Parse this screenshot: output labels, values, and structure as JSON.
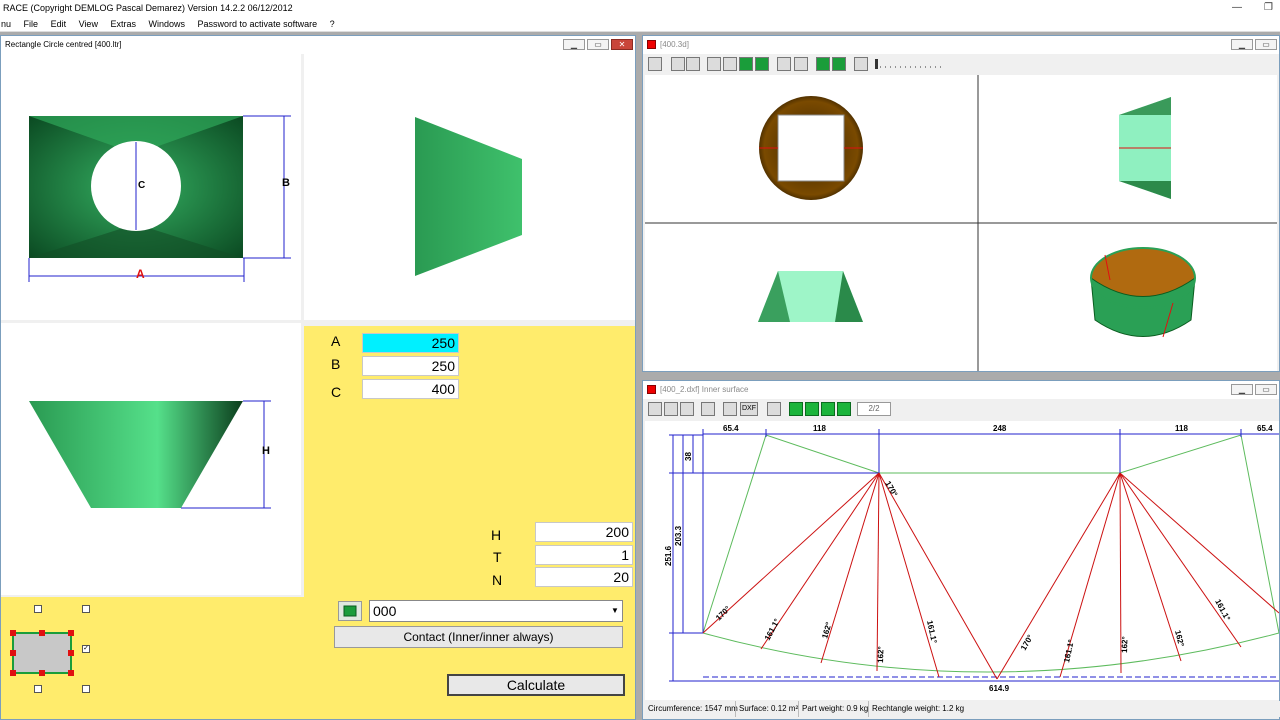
{
  "app": {
    "title": "RACE  (Copyright DEMLOG Pascal Demarez)  Version 14.2.2  06/12/2012",
    "minimize": "—",
    "restore": "❐"
  },
  "menu": [
    "nu",
    "File",
    "Edit",
    "View",
    "Extras",
    "Windows",
    "Password to activate software",
    "?"
  ],
  "window1": {
    "title": "Rectangle Circle centred  [400.ltr]",
    "labels": {
      "a": "A",
      "b": "B",
      "c": "C",
      "h": "H"
    },
    "params": [
      {
        "label": "A",
        "value": "250"
      },
      {
        "label": "B",
        "value": "250"
      },
      {
        "label": "C",
        "value": "400"
      },
      {
        "label": "H",
        "value": "200"
      },
      {
        "label": "T",
        "value": "1"
      },
      {
        "label": "N",
        "value": "20"
      }
    ],
    "combo_value": "000",
    "contact_label": "Contact (Inner/inner always)",
    "calculate_label": "Calculate",
    "check_mark": "✓"
  },
  "window2": {
    "title": "[400.3d]"
  },
  "window3": {
    "title": "[400_2.dxf]  Inner surface",
    "page": "2/2",
    "dxf_label": "DXF",
    "dims_top": [
      "65.4",
      "118",
      "248",
      "118",
      "65.4"
    ],
    "dims_left": [
      "38",
      "203.3",
      "251.6"
    ],
    "dim_bottom": "614.9",
    "angles": [
      "170°",
      "170°",
      "161.1°",
      "162°",
      "161.1°",
      "162°",
      "170°",
      "161.1°",
      "162°",
      "162°",
      "161.1°"
    ],
    "status": {
      "circumference": "Circumference: 1547 mm",
      "surface": "Surface: 0.12 m²",
      "part_weight": "Part weight: 0.9 kg",
      "rect_weight": "Rechtangle weight: 1.2 kg"
    }
  },
  "colors": {
    "accent_yellow": "#ffec6c",
    "highlight_cyan": "#00f0ff",
    "dim_blue": "#2222cc",
    "line_red": "#cc1111",
    "line_green": "#5dbb5d"
  }
}
